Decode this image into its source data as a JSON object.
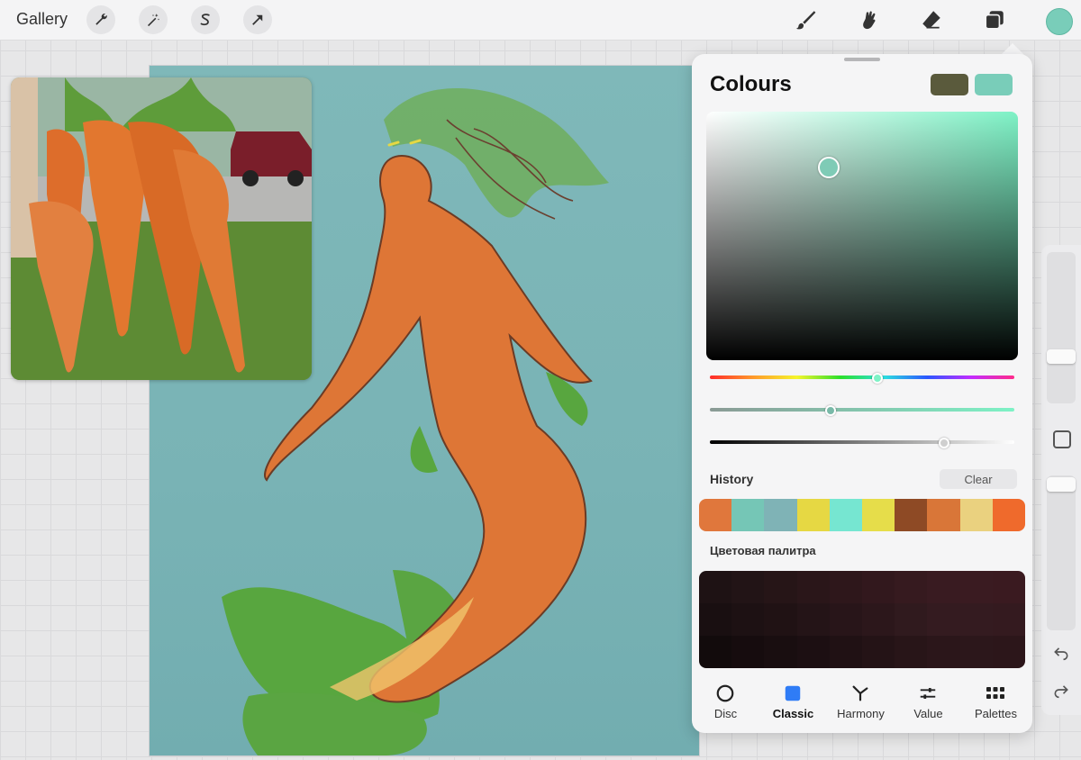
{
  "topbar": {
    "gallery_label": "Gallery",
    "left_tools": [
      {
        "name": "wrench-icon"
      },
      {
        "name": "magic-wand-icon"
      },
      {
        "name": "selection-icon"
      },
      {
        "name": "transform-arrow-icon"
      }
    ],
    "right_tools": [
      {
        "name": "brush-icon"
      },
      {
        "name": "smudge-icon"
      },
      {
        "name": "eraser-icon"
      },
      {
        "name": "layers-icon"
      }
    ],
    "active_color": "#79cdb9"
  },
  "colours_panel": {
    "title": "Colours",
    "previous_color": "#5a5a3c",
    "current_color": "#79cdb9",
    "history_label": "History",
    "clear_label": "Clear",
    "history_colors": [
      "#e0773c",
      "#75c6b6",
      "#7fb3b6",
      "#e6d843",
      "#76e6d1",
      "#e6dd4a",
      "#8e4a25",
      "#d97638",
      "#ead17f",
      "#ef6a2c"
    ],
    "palette_label": "Цветовая палитра",
    "palette_colors": [
      "#1e1214",
      "#221416",
      "#261517",
      "#2a1619",
      "#2e171b",
      "#32181d",
      "#361a1f",
      "#391b21",
      "#3a1b21",
      "#3a1a20",
      "#190f11",
      "#1d1113",
      "#201214",
      "#241417",
      "#281519",
      "#2c171b",
      "#301a1e",
      "#341b20",
      "#341b20",
      "#341a1f",
      "#120b0c",
      "#160c0e",
      "#190e10",
      "#1c0f12",
      "#201114",
      "#241316",
      "#281518",
      "#2b161a",
      "#2c171b",
      "#2c161a"
    ],
    "tabs": [
      {
        "label": "Disc",
        "icon": "disc-icon"
      },
      {
        "label": "Classic",
        "icon": "classic-icon"
      },
      {
        "label": "Harmony",
        "icon": "harmony-icon"
      },
      {
        "label": "Value",
        "icon": "value-icon"
      },
      {
        "label": "Palettes",
        "icon": "palettes-icon"
      }
    ],
    "active_tab": "Classic"
  }
}
